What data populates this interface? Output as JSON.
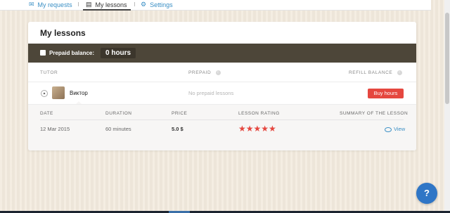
{
  "nav": {
    "items": [
      {
        "label": "My requests",
        "icon": "envelope-icon"
      },
      {
        "label": "My lessons",
        "icon": "book-icon"
      },
      {
        "label": "Settings",
        "icon": "gear-icon"
      }
    ],
    "active": "My lessons"
  },
  "card": {
    "title": "My lessons",
    "balance_label": "Prepaid balance:",
    "balance_value": "0 hours"
  },
  "table": {
    "headers": {
      "tutor": "TUTOR",
      "prepaid": "PREPAID",
      "refill": "REFILL BALANCE"
    },
    "tutor": {
      "toggle": "▲",
      "name": "Виктор",
      "prepaid_status": "No prepaid lessons",
      "buy_label": "Buy hours"
    },
    "lessons": {
      "headers": {
        "date": "DATE",
        "duration": "DURATION",
        "price": "PRICE",
        "rating": "LESSON RATING",
        "summary": "SUMMARY OF THE LESSON"
      },
      "rows": [
        {
          "date": "12 Mar 2015",
          "duration": "60 minutes",
          "price": "5.0 $",
          "rating": 5,
          "stars": "★★★★★",
          "view_label": "View"
        }
      ]
    }
  },
  "chat": {
    "icon": "chat-help-icon",
    "glyph": "?"
  },
  "colors": {
    "accent": "#e5473f",
    "link": "#3a8fc5",
    "balance_bar": "#4d4639",
    "chat": "#2f76c6"
  }
}
